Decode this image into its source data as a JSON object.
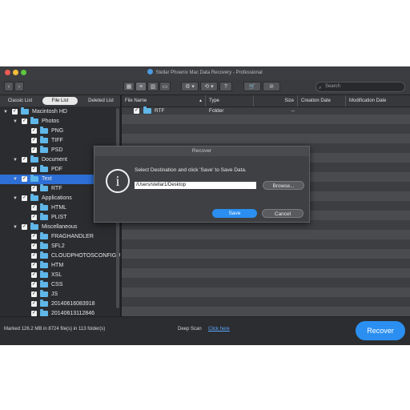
{
  "window": {
    "title": "Stellar Phoenix Mac Data Recovery - Professional"
  },
  "toolbar": {
    "buttons": [
      {
        "name": "back-button",
        "glyph": "‹"
      },
      {
        "name": "forward-button",
        "glyph": "›"
      },
      {
        "name": "icon-view-button",
        "glyph": "▦"
      },
      {
        "name": "list-view-button",
        "glyph": "≡"
      },
      {
        "name": "column-view-button",
        "glyph": "▥"
      },
      {
        "name": "coverflow-view-button",
        "glyph": "▭"
      },
      {
        "name": "settings-menu-button",
        "glyph": "⚙ ▾"
      },
      {
        "name": "history-menu-button",
        "glyph": "⟲ ▾"
      },
      {
        "name": "help-button",
        "glyph": "?"
      },
      {
        "name": "cart-button",
        "glyph": "🛒"
      },
      {
        "name": "activation-button",
        "glyph": "⊘"
      }
    ],
    "search_placeholder": "Search"
  },
  "left_tabs": [
    "Classic List",
    "File List",
    "Deleted List"
  ],
  "tree": [
    {
      "label": "Macintosh HD",
      "depth": 0,
      "expanded": true
    },
    {
      "label": "Photos",
      "depth": 1,
      "expanded": true
    },
    {
      "label": "PNG",
      "depth": 2
    },
    {
      "label": "TIFF",
      "depth": 2
    },
    {
      "label": "PSD",
      "depth": 2
    },
    {
      "label": "Document",
      "depth": 1,
      "expanded": true
    },
    {
      "label": "PDF",
      "depth": 2
    },
    {
      "label": "Text",
      "depth": 1,
      "expanded": true,
      "selected": true
    },
    {
      "label": "RTF",
      "depth": 2
    },
    {
      "label": "Applications",
      "depth": 1,
      "expanded": true
    },
    {
      "label": "HTML",
      "depth": 2
    },
    {
      "label": "PLIST",
      "depth": 2
    },
    {
      "label": "Miscellaneous",
      "depth": 1,
      "expanded": true
    },
    {
      "label": "FRAGHANDLER",
      "depth": 2
    },
    {
      "label": "SFL2",
      "depth": 2
    },
    {
      "label": "CLOUDPHOTOSCONFIGU",
      "depth": 2
    },
    {
      "label": "HTM",
      "depth": 2
    },
    {
      "label": "XSL",
      "depth": 2
    },
    {
      "label": "CSS",
      "depth": 2
    },
    {
      "label": "JS",
      "depth": 2
    },
    {
      "label": "20140616083918",
      "depth": 2
    },
    {
      "label": "20140613112846",
      "depth": 2
    }
  ],
  "file_list": {
    "columns": [
      "File Name",
      "Type",
      "Size",
      "Creation Date",
      "Modification Date"
    ],
    "rows": [
      {
        "name": "RTF",
        "type": "Folder",
        "size": "--",
        "created": "",
        "modified": ""
      }
    ]
  },
  "status": {
    "summary": "Marked 126.2 MB in 8724 file(s) in 113 folder(s)",
    "deep_scan_label": "Deep Scan",
    "click_here": "Click here",
    "recover_label": "Recover"
  },
  "dialog": {
    "title": "Recover",
    "message": "Select Destination and click 'Save' to Save Data.",
    "path": "/Users/stellar1/Desktop",
    "browse_label": "Browse...",
    "save_label": "Save",
    "cancel_label": "Cancel"
  },
  "colors": {
    "accent": "#2a8ff0",
    "selection": "#2d6fd6",
    "folder": "#5fb6e8",
    "close_dot": "#ee5b52",
    "minimize_dot": "#f4bd3b",
    "zoom_dot": "#5ec640"
  }
}
